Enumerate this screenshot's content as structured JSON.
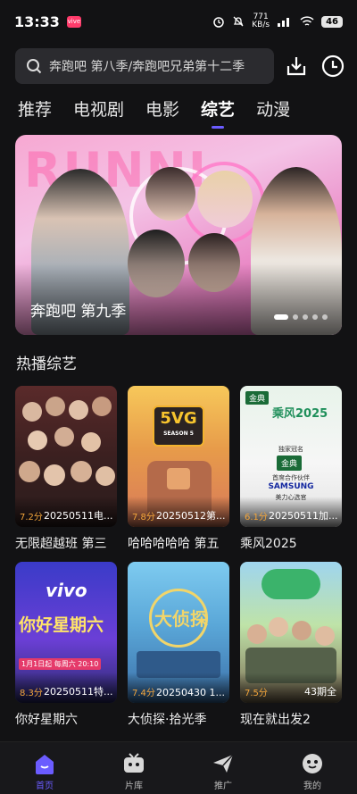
{
  "status_bar": {
    "time": "13:33",
    "app_badge": "vive",
    "net_speed": "771",
    "net_unit": "KB/s",
    "signal": "5G",
    "battery": "46"
  },
  "search": {
    "placeholder": "奔跑吧 第八季/奔跑吧兄弟第十二季"
  },
  "tabs": [
    {
      "label": "推荐",
      "active": false
    },
    {
      "label": "电视剧",
      "active": false
    },
    {
      "label": "电影",
      "active": false
    },
    {
      "label": "综艺",
      "active": true
    },
    {
      "label": "动漫",
      "active": false
    }
  ],
  "banner": {
    "title": "奔跑吧 第九季",
    "brand_text": "RUNNI",
    "slide_count": 5,
    "active_slide": 1
  },
  "section": {
    "title": "热播综艺"
  },
  "cards": [
    {
      "name": "无限超越班 第三",
      "score": "7.2分",
      "episode": "20250511电..."
    },
    {
      "name": "哈哈哈哈哈 第五",
      "score": "7.8分",
      "episode": "20250512第..."
    },
    {
      "name": "乘风2025",
      "score": "6.1分",
      "episode": "20250511加..."
    },
    {
      "name": "你好星期六",
      "score": "8.3分",
      "episode": "20250511特..."
    },
    {
      "name": "大侦探·拾光季",
      "score": "7.4分",
      "episode": "20250430 1..."
    },
    {
      "name": "现在就出发2",
      "score": "7.5分",
      "episode": "43期全"
    }
  ],
  "poster_text": {
    "p2_logo": "5VG",
    "p2_sub": "SEASON 5",
    "p3_brand": "金典",
    "p3_title": "乘风2025",
    "p3_line1": "独家冠名",
    "p3_line2": "首席合作伙伴",
    "p3_sponsor": "SAMSUNG",
    "p3_line3": "美力心选官",
    "p4_brand": "vivo",
    "p4_title": "你好星期六",
    "p4_time": "1月1日起 每周六 20:10",
    "p5_title": "大侦探"
  },
  "bottom_nav": [
    {
      "label": "首页",
      "icon": "home-icon",
      "active": true
    },
    {
      "label": "片库",
      "icon": "library-icon",
      "active": false
    },
    {
      "label": "推广",
      "icon": "send-icon",
      "active": false
    },
    {
      "label": "我的",
      "icon": "profile-icon",
      "active": false
    }
  ],
  "colors": {
    "accent": "#6b5cff",
    "score": "#f3a53b",
    "background": "#121214"
  }
}
